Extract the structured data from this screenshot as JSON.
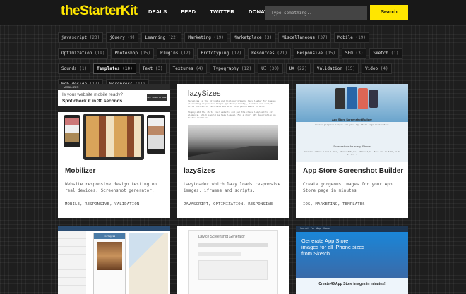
{
  "header": {
    "logo": "theStarterKit",
    "nav": [
      "DEALS",
      "FEED",
      "TWITTER",
      "DONATE"
    ],
    "search_placeholder": "Type something...",
    "search_button": "Search"
  },
  "tags": [
    {
      "label": "javascript",
      "count": "(23)"
    },
    {
      "label": "jQuery",
      "count": "(9)"
    },
    {
      "label": "Learning",
      "count": "(22)"
    },
    {
      "label": "Marketing",
      "count": "(19)"
    },
    {
      "label": "Marketplace",
      "count": "(3)"
    },
    {
      "label": "Miscellaneous",
      "count": "(37)"
    },
    {
      "label": "Mobile",
      "count": "(19)"
    },
    {
      "label": "Optimization",
      "count": "(19)"
    },
    {
      "label": "Photoshop",
      "count": "(15)"
    },
    {
      "label": "Plugins",
      "count": "(12)"
    },
    {
      "label": "Prototyping",
      "count": "(17)"
    },
    {
      "label": "Resources",
      "count": "(21)"
    },
    {
      "label": "Responsive",
      "count": "(15)"
    },
    {
      "label": "SEO",
      "count": "(3)"
    },
    {
      "label": "Sketch",
      "count": "(1)"
    },
    {
      "label": "Sounds",
      "count": "(1)"
    },
    {
      "label": "Templates",
      "count": "(10)",
      "active": true
    },
    {
      "label": "Text",
      "count": "(3)"
    },
    {
      "label": "Textures",
      "count": "(4)"
    },
    {
      "label": "Typography",
      "count": "(12)"
    },
    {
      "label": "UI",
      "count": "(30)"
    },
    {
      "label": "UX",
      "count": "(22)"
    },
    {
      "label": "Validation",
      "count": "(15)"
    },
    {
      "label": "Video",
      "count": "(4)"
    },
    {
      "label": "Web design",
      "count": "(17)"
    },
    {
      "label": "Wordpress",
      "count": "(11)"
    }
  ],
  "cards": [
    {
      "title": "Mobilizer",
      "desc": "Website responsive design testing on real devices. Screenshot generator.",
      "tags": "MOBILE, RESPONSIVE, VALIDATION",
      "thumb": {
        "brand": "MOBILIZER",
        "headline1": "Is your website mobile ready?",
        "headline2": "Spot check it in 30 seconds.",
        "cta": "GET DESKTOP APP"
      }
    },
    {
      "title": "lazySizes",
      "desc": "LazyLoader which lazy loads responsive images, iframes and scripts.",
      "tags": "JAVASCRIPT, OPTIMIZATION, RESPONSIVE",
      "thumb": {
        "heading": "lazySizes",
        "p1": "lazySizes is the ultimate and high-performance lazy loader for images (including responsive images (picture/srcset)), iframes and scripts. It is written in VanillaJS and with high performance in mind.",
        "p2": "Simply add the JS to your website and put the class lazyload to all elements, which should be lazy loaded. For a short API description go to the readme.md."
      }
    },
    {
      "title": "App Store Screenshot Builder",
      "desc": "Create gorgeous images for your App Store page in minutes",
      "tags": "IOS, MARKETING, TEMPLATES",
      "thumb": {
        "heading": "App Store Screenshot Builder",
        "sub": "Create gorgeous images for your App Store page in minutes!",
        "section": "Screenshots for every iPhone",
        "section_sub": "Includes iPhone 6 and 6 Plus, iPhone 5/5s/5c, iPhone 4/4s. Each set is 5.5\", 4.7\" 4\" 3.5\"."
      }
    }
  ],
  "row2": [
    {
      "label": "Instagram"
    },
    {
      "label": "Device Screenshot Generator"
    },
    {
      "topbar": "Search for App Store",
      "h1": "Generate App Store images for all iPhone sizes from Sketch",
      "cta": "Create 45 App Store images in minutes!"
    }
  ],
  "colors": {
    "accent": "#ffe600",
    "background": "#1e1e1e"
  }
}
